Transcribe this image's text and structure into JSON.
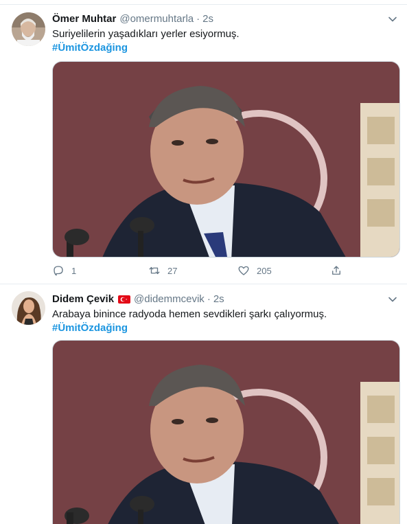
{
  "tweets": [
    {
      "author_name": "Ömer Muhtar",
      "handle": "@omermuhtarla",
      "separator": "·",
      "time": "2s",
      "text": "Suriyelilerin yaşadıkları yerler esiyormuş.",
      "hashtag": "#ÜmitÖzdağing",
      "replies": "1",
      "retweets": "27",
      "likes": "205",
      "media_icon": "photo-man-at-microphone"
    },
    {
      "author_name": "Didem Çevik",
      "flag_icon": "turkey-flag-icon",
      "handle": "@didemmcevik",
      "separator": "·",
      "time": "2s",
      "text": "Arabaya binince radyoda hemen sevdikleri şarkı çalıyormuş.",
      "hashtag": "#ÜmitÖzdağing",
      "media_icon": "photo-man-at-microphone"
    }
  ],
  "colors": {
    "link": "#1b95e0",
    "secondary_text": "#657786",
    "border": "#e6ecf0"
  }
}
